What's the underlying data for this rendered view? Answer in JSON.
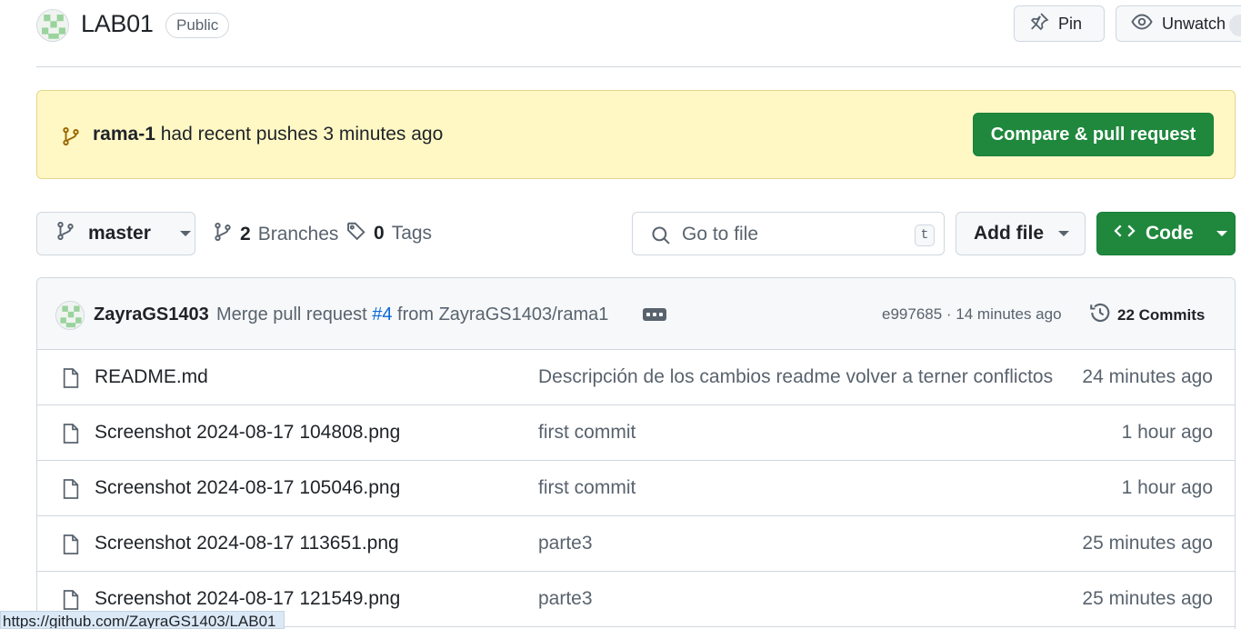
{
  "repo": {
    "name": "LAB01",
    "visibility": "Public",
    "pin_label": "Pin",
    "unwatch_label": "Unwatch"
  },
  "banner": {
    "branch": "rama-1",
    "message": "had recent pushes 3 minutes ago",
    "compare_label": "Compare & pull request"
  },
  "toolbar": {
    "branch": "master",
    "branches_count": "2",
    "branches_label": "Branches",
    "tags_count": "0",
    "tags_label": "Tags",
    "search_placeholder": "Go to file",
    "search_shortcut": "t",
    "add_file_label": "Add file",
    "code_label": "Code"
  },
  "latest_commit": {
    "author": "ZayraGS1403",
    "message_prefix": "Merge pull request",
    "pr_number": "#4",
    "message_suffix": "from ZayraGS1403/rama1",
    "hash_time": "e997685 · 14 minutes ago",
    "commits_label": "22 Commits"
  },
  "files": [
    {
      "name": "README.md",
      "commit": "Descripción de los cambios readme volver a terner conflictos",
      "time": "24 minutes ago"
    },
    {
      "name": "Screenshot 2024-08-17 104808.png",
      "commit": "first commit",
      "time": "1 hour ago"
    },
    {
      "name": "Screenshot 2024-08-17 105046.png",
      "commit": "first commit",
      "time": "1 hour ago"
    },
    {
      "name": "Screenshot 2024-08-17 113651.png",
      "commit": "parte3",
      "time": "25 minutes ago"
    },
    {
      "name": "Screenshot 2024-08-17 121549.png",
      "commit": "parte3",
      "time": "25 minutes ago"
    }
  ],
  "status_bar": {
    "url": "https://github.com/ZayraGS1403/LAB01"
  },
  "colors": {
    "primary_button": "#1f883d",
    "banner_bg": "#fff8c5",
    "link": "#0969da",
    "muted_text": "#59636e"
  }
}
